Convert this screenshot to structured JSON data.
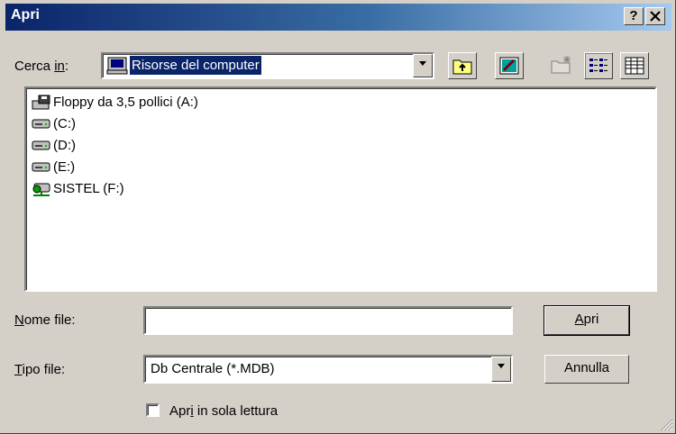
{
  "window": {
    "title": "Apri",
    "help_label": "?",
    "close_label": "×"
  },
  "lookin": {
    "label_prefix": "Cerca ",
    "label_underlined": "in",
    "label_suffix": ":",
    "value": "Risorse del computer",
    "icon": "my-computer-icon"
  },
  "toolbar": [
    {
      "name": "up-one-level",
      "icon": "folder-up-icon"
    },
    {
      "name": "desktop",
      "icon": "desktop-icon"
    },
    {
      "name": "new-folder",
      "icon": "new-folder-icon",
      "disabled": true
    },
    {
      "name": "list-view",
      "icon": "list-view-icon"
    },
    {
      "name": "details-view",
      "icon": "details-view-icon"
    }
  ],
  "files": [
    {
      "label": "Floppy da 3,5 pollici (A:)",
      "icon": "floppy-drive-icon"
    },
    {
      "label": "(C:)",
      "icon": "hard-drive-icon"
    },
    {
      "label": "(D:)",
      "icon": "hard-drive-icon"
    },
    {
      "label": "(E:)",
      "icon": "hard-drive-icon"
    },
    {
      "label": "SISTEL (F:)",
      "icon": "network-drive-icon"
    }
  ],
  "filename": {
    "label_underlined": "N",
    "label_rest": "ome file:",
    "value": ""
  },
  "filetype": {
    "label_underlined": "T",
    "label_rest": "ipo file:",
    "value": "Db Centrale (*.MDB)"
  },
  "buttons": {
    "open_underlined": "A",
    "open_rest": "pri",
    "cancel": "Annulla"
  },
  "readonly": {
    "label_prefix": "Apr",
    "label_underlined": "i",
    "label_suffix": " in sola lettura",
    "checked": false
  },
  "colors": {
    "face": "#d4d0c8",
    "title_start": "#0a246a",
    "title_end": "#a6caf0",
    "selection": "#0a246a"
  }
}
